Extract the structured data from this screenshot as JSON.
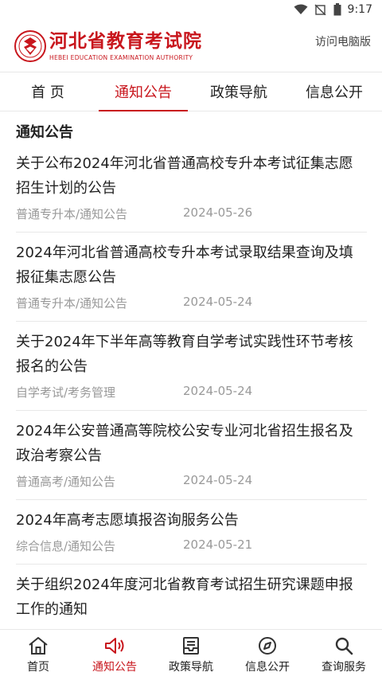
{
  "status": {
    "time": "9:17"
  },
  "header": {
    "title": "河北省教育考试院",
    "subtitle": "HEBEI EDUCATION EXAMINATION AUTHORITY",
    "desktop_link": "访问电脑版"
  },
  "nav": {
    "tabs": [
      {
        "label": "首 页"
      },
      {
        "label": "通知公告",
        "active": true
      },
      {
        "label": "政策导航"
      },
      {
        "label": "信息公开"
      }
    ]
  },
  "section": {
    "title": "通知公告"
  },
  "items": [
    {
      "title": "关于公布2024年河北省普通高校专升本考试征集志愿招生计划的公告",
      "category": "普通专升本/通知公告",
      "date": "2024-05-26"
    },
    {
      "title": "2024年河北省普通高校专升本考试录取结果查询及填报征集志愿公告",
      "category": "普通专升本/通知公告",
      "date": "2024-05-24"
    },
    {
      "title": "关于2024年下半年高等教育自学考试实践性环节考核报名的公告",
      "category": "自学考试/考务管理",
      "date": "2024-05-24"
    },
    {
      "title": "2024年公安普通高等院校公安专业河北省招生报名及政治考察公告",
      "category": "普通高考/通知公告",
      "date": "2024-05-24"
    },
    {
      "title": "2024年高考志愿填报咨询服务公告",
      "category": "综合信息/通知公告",
      "date": "2024-05-21"
    },
    {
      "title": "关于组织2024年度河北省教育考试招生研究课题申报工作的通知",
      "category": "",
      "date": ""
    }
  ],
  "tabbar": {
    "tabs": [
      {
        "label": "首页",
        "icon": "home-icon"
      },
      {
        "label": "通知公告",
        "icon": "megaphone-icon",
        "active": true
      },
      {
        "label": "政策导航",
        "icon": "inbox-icon"
      },
      {
        "label": "信息公开",
        "icon": "compass-icon"
      },
      {
        "label": "查询服务",
        "icon": "search-icon"
      }
    ]
  },
  "colors": {
    "accent": "#c8161d",
    "muted": "#999999"
  }
}
